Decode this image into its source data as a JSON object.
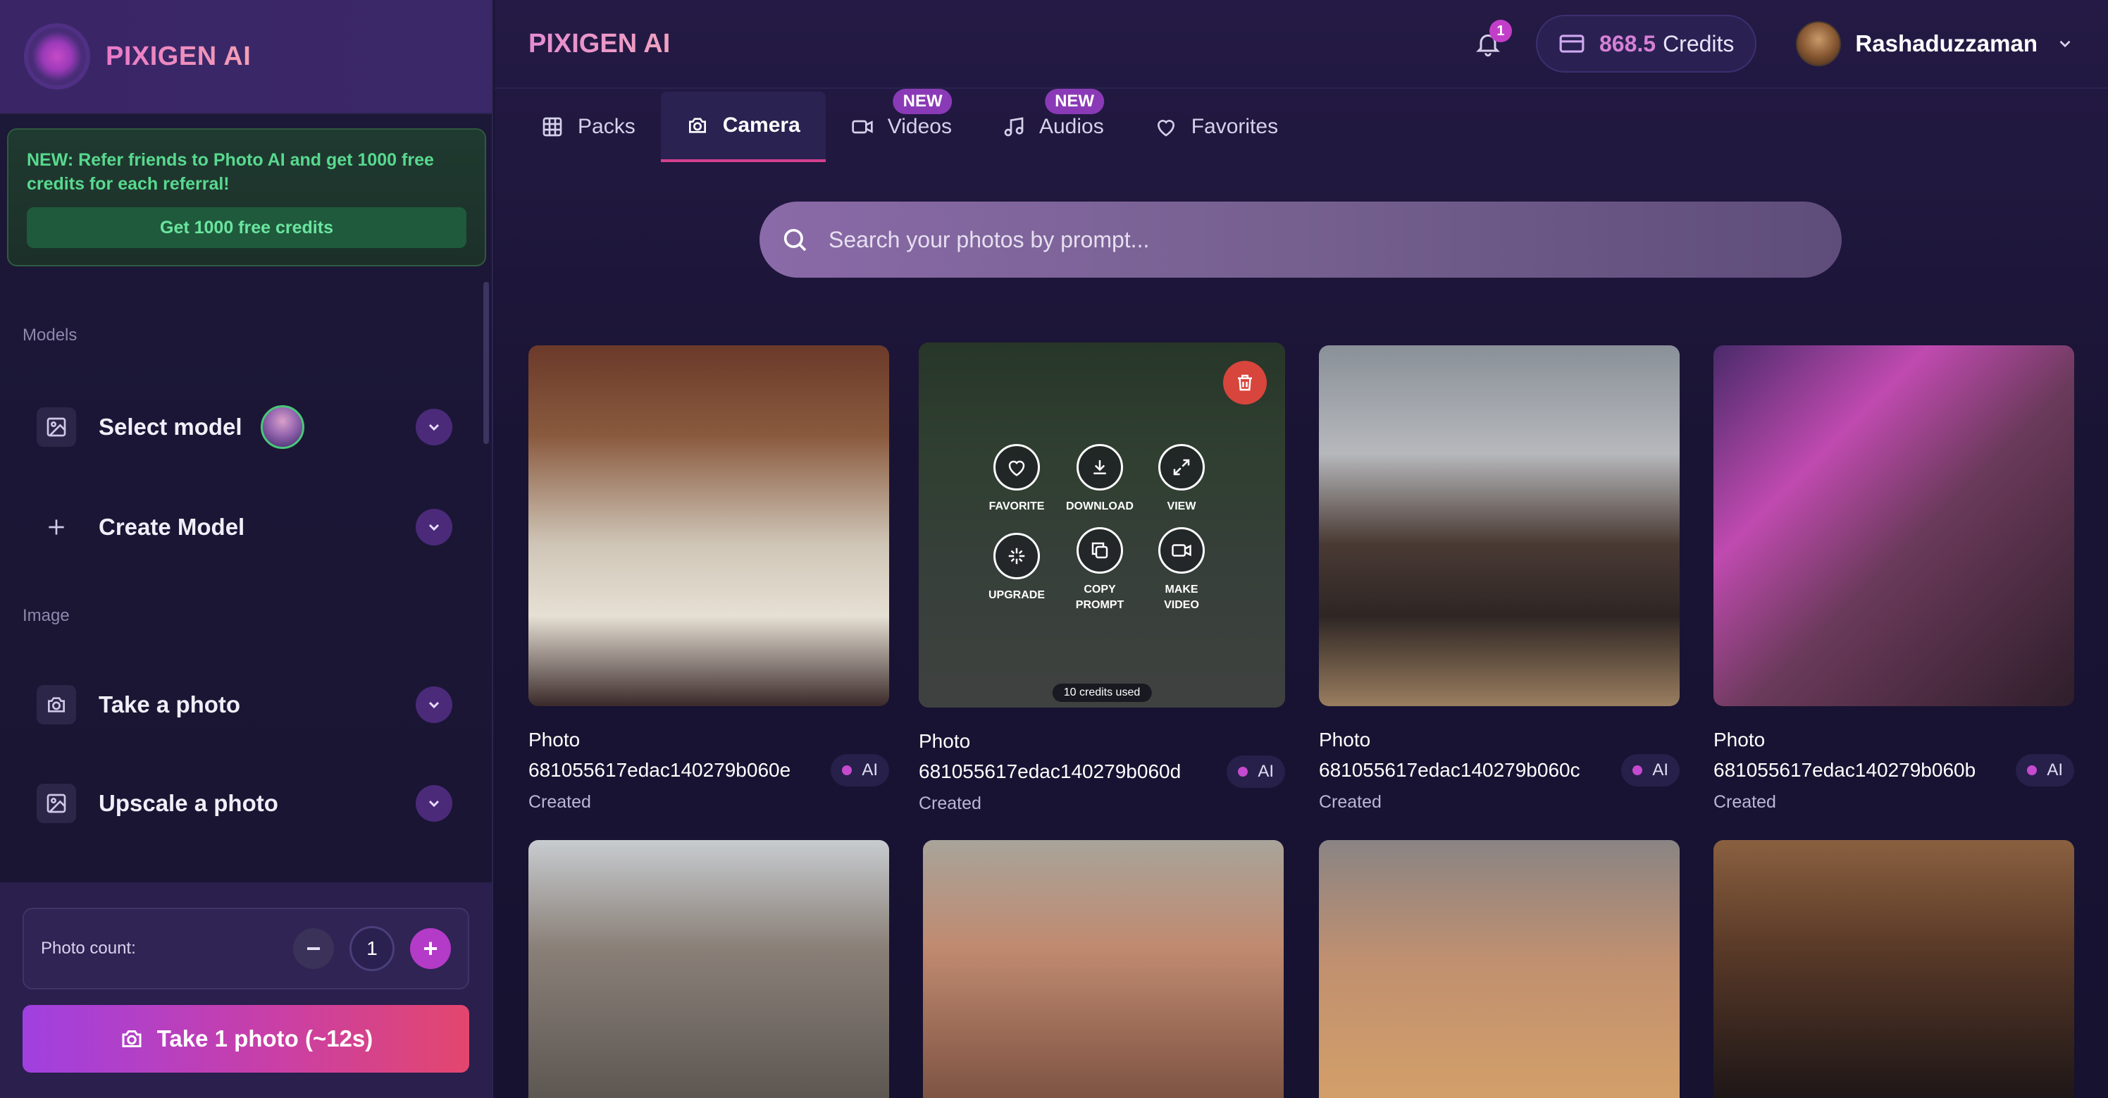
{
  "brand": "PIXIGEN AI",
  "sidebar": {
    "logo_text": "PIXIGEN AI",
    "referral_text": "NEW: Refer friends to Photo AI and get 1000 free credits for each referral!",
    "referral_button": "Get 1000 free credits",
    "models_label": "Models",
    "image_label": "Image",
    "items": [
      {
        "label": "Select model",
        "icon": "image-icon"
      },
      {
        "label": "Create Model",
        "icon": "plus-icon"
      },
      {
        "label": "Take a photo",
        "icon": "camera-icon"
      },
      {
        "label": "Upscale a photo",
        "icon": "image-icon"
      }
    ],
    "photo_count_label": "Photo count:",
    "photo_count_value": "1",
    "minus": "−",
    "plus": "+",
    "take_button": "Take 1 photo (~12s)"
  },
  "header": {
    "notifications": "1",
    "credits_value": "868.5",
    "credits_label": "Credits",
    "user_name": "Rashaduzzaman"
  },
  "tabs": [
    {
      "label": "Packs",
      "icon": "grid-icon",
      "badge": ""
    },
    {
      "label": "Camera",
      "icon": "camera-icon",
      "badge": "",
      "active": true
    },
    {
      "label": "Videos",
      "icon": "video-icon",
      "badge": "NEW"
    },
    {
      "label": "Audios",
      "icon": "music-icon",
      "badge": "NEW"
    },
    {
      "label": "Favorites",
      "icon": "heart-icon",
      "badge": ""
    }
  ],
  "search": {
    "placeholder": "Search your photos by prompt..."
  },
  "photos": [
    {
      "title": "Photo",
      "id": "681055617edac140279b060e",
      "badge": "AI",
      "status": "Created"
    },
    {
      "title": "Photo",
      "id": "681055617edac140279b060d",
      "badge": "AI",
      "status": "Created"
    },
    {
      "title": "Photo",
      "id": "681055617edac140279b060c",
      "badge": "AI",
      "status": "Created"
    },
    {
      "title": "Photo",
      "id": "681055617edac140279b060b",
      "badge": "AI",
      "status": "Created"
    }
  ],
  "overlay": {
    "favorite": "FAVORITE",
    "download": "DOWNLOAD",
    "view": "VIEW",
    "upgrade": "UPGRADE",
    "copy": "COPY",
    "prompt": "PROMPT",
    "make": "MAKE",
    "video": "VIDEO",
    "credits_used": "10 credits used"
  },
  "colors": {
    "accent": "#c54ad0",
    "danger": "#d8453c",
    "success": "#58d98f"
  }
}
